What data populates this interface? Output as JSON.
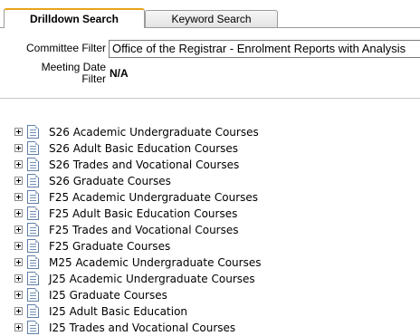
{
  "tabs": [
    {
      "label": "Drilldown Search",
      "active": true
    },
    {
      "label": "Keyword Search",
      "active": false
    }
  ],
  "filters": {
    "committee_label": "Committee Filter",
    "committee_value": "Office of the Registrar - Enrolment Reports with Analysis",
    "meeting_label_line1": "Meeting Date",
    "meeting_label_line2": "Filter",
    "meeting_value": "N/A"
  },
  "tree": {
    "items": [
      {
        "label": "S26 Academic Undergraduate Courses"
      },
      {
        "label": "S26 Adult Basic Education Courses"
      },
      {
        "label": "S26 Trades and Vocational Courses"
      },
      {
        "label": "S26 Graduate Courses"
      },
      {
        "label": "F25 Academic Undergraduate Courses"
      },
      {
        "label": "F25 Adult Basic Education Courses"
      },
      {
        "label": "F25 Trades and Vocational Courses"
      },
      {
        "label": "F25 Graduate Courses"
      },
      {
        "label": "M25 Academic Undergraduate Courses"
      },
      {
        "label": "J25 Academic Undergraduate Courses"
      },
      {
        "label": "I25 Graduate Courses"
      },
      {
        "label": "I25 Adult Basic Education"
      },
      {
        "label": "I25 Trades and Vocational Courses"
      }
    ]
  },
  "icons": {
    "expander": "plus-square-icon",
    "node": "document-icon"
  },
  "colors": {
    "active_tab_accent": "#e8a317",
    "tab_border": "#9a9a9a",
    "doc_icon_border": "#5f7fa8"
  }
}
